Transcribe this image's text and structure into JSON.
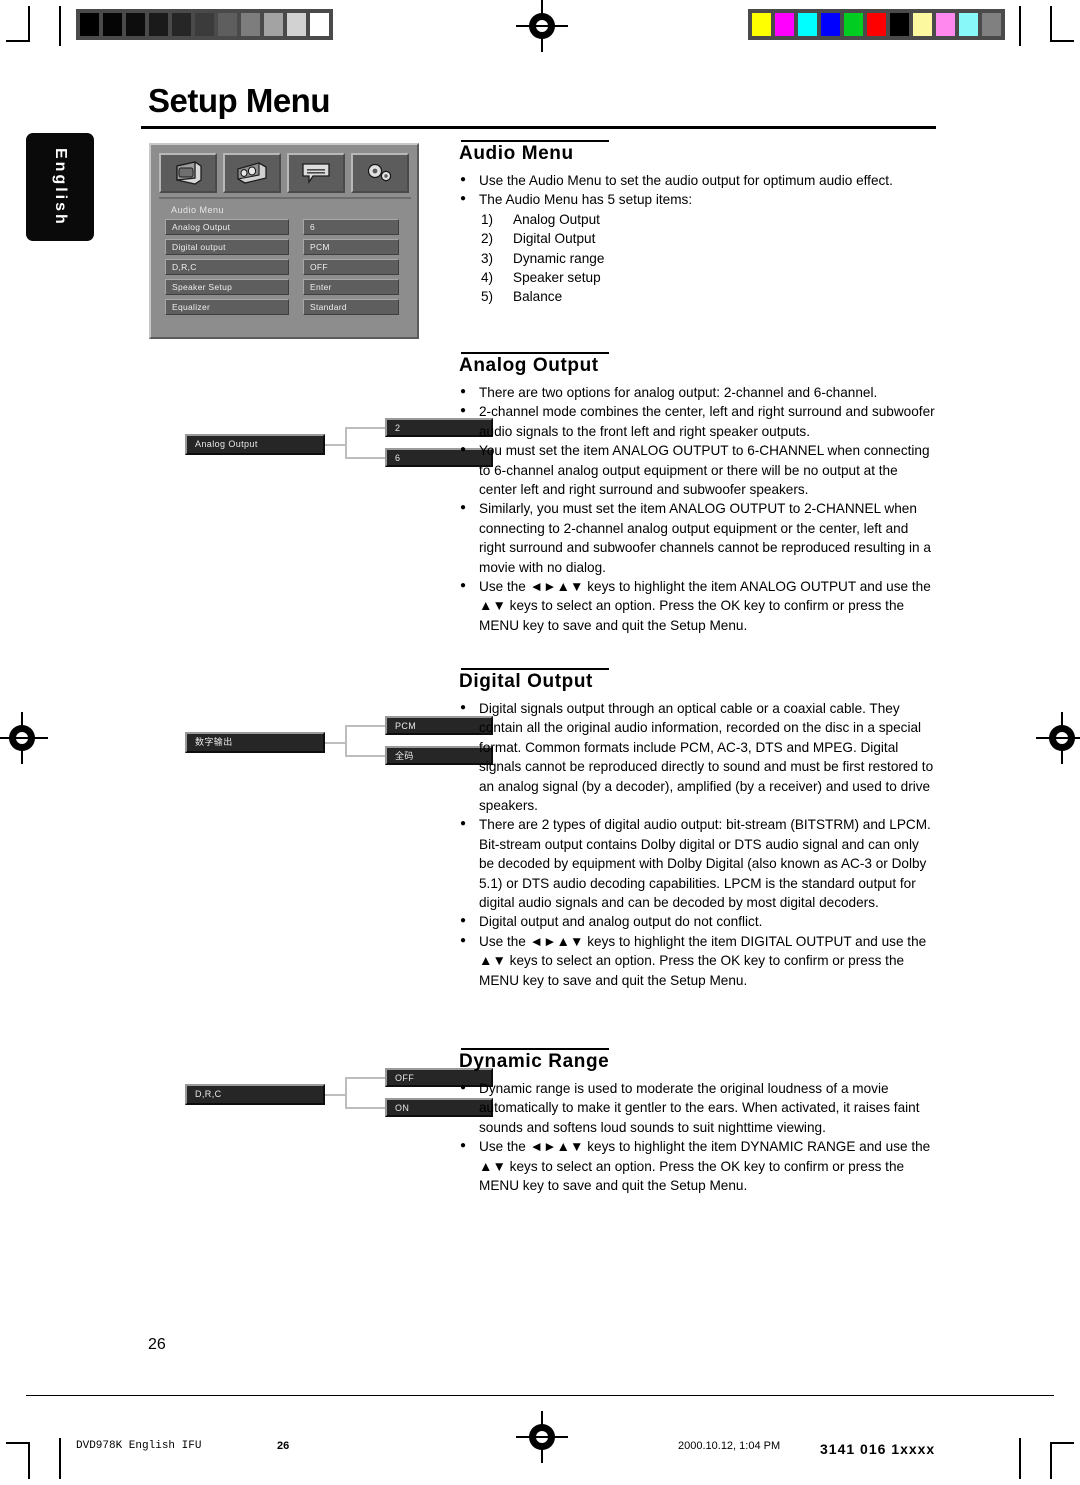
{
  "page": {
    "title": "Setup Menu",
    "language_tab": "English",
    "folio": "26"
  },
  "swatches": {
    "left": [
      "#000000",
      "#050505",
      "#0d0d0d",
      "#1a1a1a",
      "#262626",
      "#3b3b3b",
      "#5e5e5e",
      "#7d7d7d",
      "#a3a3a3",
      "#d2d2d2",
      "#ffffff"
    ],
    "right": [
      "#ffff00",
      "#ff00ff",
      "#00ffff",
      "#0000ff",
      "#00cc22",
      "#ff0000",
      "#000000",
      "#fcf8a0",
      "#ff88ee",
      "#88f8f8",
      "#808080"
    ]
  },
  "osd": {
    "title": "Audio Menu",
    "icons": [
      "tv-icon",
      "speaker-icon",
      "subtitle-icon",
      "gears-icon"
    ],
    "rows": [
      {
        "label": "Analog Output",
        "value": "6"
      },
      {
        "label": "Digital  output",
        "value": "PCM"
      },
      {
        "label": "D,R,C",
        "value": "OFF"
      },
      {
        "label": "Speaker  Setup",
        "value": "Enter"
      },
      {
        "label": "Equalizer",
        "value": "Standard"
      }
    ]
  },
  "diagrams": [
    {
      "name": "analog-output",
      "main": "Analog Output",
      "option1": "2",
      "option2": "6"
    },
    {
      "name": "digital-output",
      "main": "数字输出",
      "option1": "PCM",
      "option2": "全码"
    },
    {
      "name": "dynamic-range",
      "main": "D,R,C",
      "option1": "OFF",
      "option2": "ON"
    }
  ],
  "sections": {
    "audio_menu": {
      "heading": "Audio Menu",
      "bullets": [
        "Use the Audio Menu to set the audio output for optimum audio effect.",
        "The Audio Menu has 5 setup items:"
      ],
      "items": [
        {
          "num": "1)",
          "text": "Analog Output"
        },
        {
          "num": "2)",
          "text": "Digital Output"
        },
        {
          "num": "3)",
          "text": "Dynamic range"
        },
        {
          "num": "4)",
          "text": "Speaker setup"
        },
        {
          "num": "5)",
          "text": "Balance"
        }
      ]
    },
    "analog_output": {
      "heading": "Analog Output",
      "bullets": [
        "There are two options for analog output: 2-channel and 6-channel.",
        "2-channel mode combines the center, left and right surround and subwoofer audio signals to the front left and right speaker outputs.",
        "You must set the item ANALOG OUTPUT to 6-CHANNEL when connecting to 6-channel analog output equipment or there will be no output at the center left and right surround and subwoofer speakers.",
        "Similarly, you must set the item ANALOG OUTPUT to 2-CHANNEL when connecting to 2-channel analog output equipment or the center, left and right surround and subwoofer channels cannot be reproduced resulting in a movie with no dialog.",
        "Use the ◄►▲▼ keys to highlight the item ANALOG OUTPUT and use the ▲▼ keys to select an option. Press the OK key to confirm or press the MENU key to save and quit the Setup Menu."
      ]
    },
    "digital_output": {
      "heading": "Digital Output",
      "bullets": [
        "Digital signals output through an optical cable or a coaxial cable. They contain all the original audio information, recorded on the disc in a special format.  Common formats include PCM, AC-3, DTS and MPEG. Digital signals cannot be reproduced directly to sound and must be first restored to an analog signal (by a decoder), amplified (by a receiver) and used to drive speakers.",
        "There are 2 types of digital audio output: bit-stream (BITSTRM) and LPCM.  Bit-stream output contains Dolby digital or DTS audio signal and can only be decoded by equipment with Dolby Digital (also known as AC-3 or Dolby 5.1) or DTS audio decoding capabilities.  LPCM is the standard output for digital audio signals and can be decoded by most digital decoders.",
        "Digital output and analog output do not conflict.",
        "Use the ◄►▲▼ keys to highlight the item DIGITAL OUTPUT and use the ▲▼ keys to select an option. Press the OK key to confirm or press the MENU key to save and quit the Setup Menu."
      ]
    },
    "dynamic_range": {
      "heading": "Dynamic Range",
      "bullets": [
        "Dynamic range is used to moderate the original loudness of a movie automatically to make it gentler to the ears. When activated, it raises faint sounds and softens loud sounds to suit nighttime viewing.",
        "Use the ◄►▲▼ keys to highlight the item DYNAMIC RANGE and use the ▲▼ keys to select an option. Press the OK key to confirm or press the MENU key to save and quit the Setup Menu."
      ]
    }
  },
  "footer": {
    "file": "DVD978K English IFU",
    "page": "26",
    "timestamp": "2000.10.12, 1:04 PM",
    "code": "3141 016 1xxxx"
  }
}
